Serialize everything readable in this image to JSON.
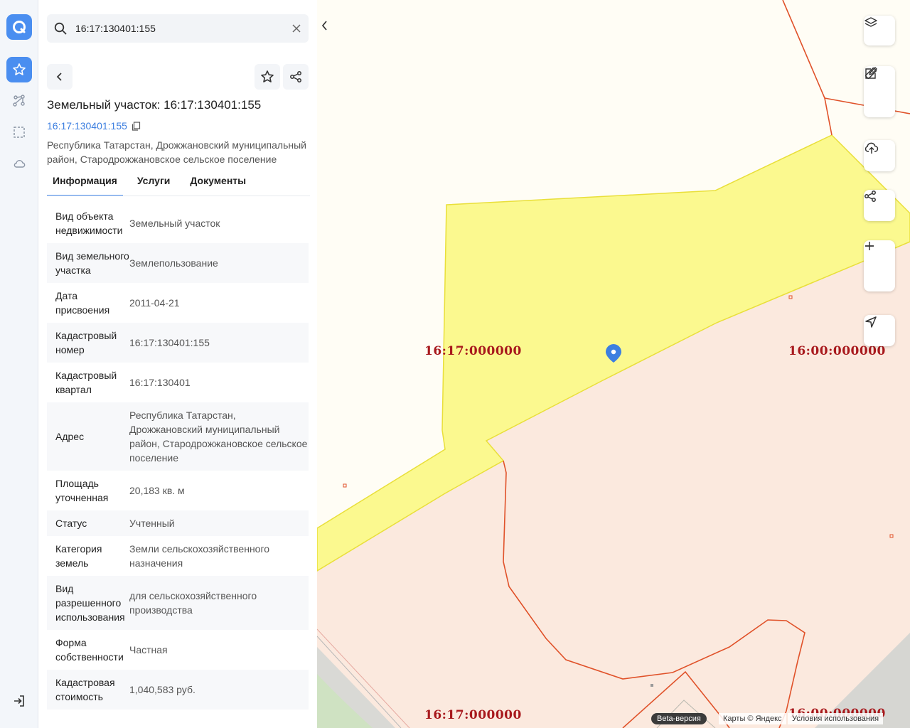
{
  "search": {
    "value": "16:17:130401:155"
  },
  "header": {
    "title": "Земельный участок: 16:17:130401:155",
    "cadastral_link": "16:17:130401:155",
    "address": "Республика Татарстан, Дрожжановский муниципальный район, Стародрожжановское сельское поселение"
  },
  "tabs": [
    {
      "label": "Информация"
    },
    {
      "label": "Услуги"
    },
    {
      "label": "Документы"
    }
  ],
  "info": [
    {
      "key": "Вид объекта недвижимости",
      "value": "Земельный участок"
    },
    {
      "key": "Вид земельного участка",
      "value": "Землепользование"
    },
    {
      "key": "Дата присвоения",
      "value": "2011-04-21"
    },
    {
      "key": "Кадастровый номер",
      "value": "16:17:130401:155"
    },
    {
      "key": "Кадастровый квартал",
      "value": "16:17:130401"
    },
    {
      "key": "Адрес",
      "value": "Республика Татарстан, Дрожжановский муниципальный район, Стародрожжановское сельское поселение"
    },
    {
      "key": "Площадь уточненная",
      "value": "20,183 кв. м"
    },
    {
      "key": "Статус",
      "value": "Учтенный"
    },
    {
      "key": "Категория земель",
      "value": "Земли сельскохозяйственного назначения"
    },
    {
      "key": "Вид разрешенного использования",
      "value": "для сельскохозяйственного производства"
    },
    {
      "key": "Форма собственности",
      "value": "Частная"
    },
    {
      "key": "Кадастровая стоимость",
      "value": "1,040,583 руб."
    }
  ],
  "map": {
    "labels": {
      "left_top": "16:17:000000",
      "right_top": "16:00:000000",
      "left_bottom": "16:17:000000",
      "right_bottom": "16:00:000000"
    },
    "beta": "Beta-версия",
    "copyright": "Карты © Яндекс",
    "terms": "Условия использования"
  },
  "colors": {
    "accent": "#4a8ef0",
    "parcel_fill": "#fbf98f",
    "district_fill": "#fbe9de",
    "boundary": "#e0522a"
  }
}
